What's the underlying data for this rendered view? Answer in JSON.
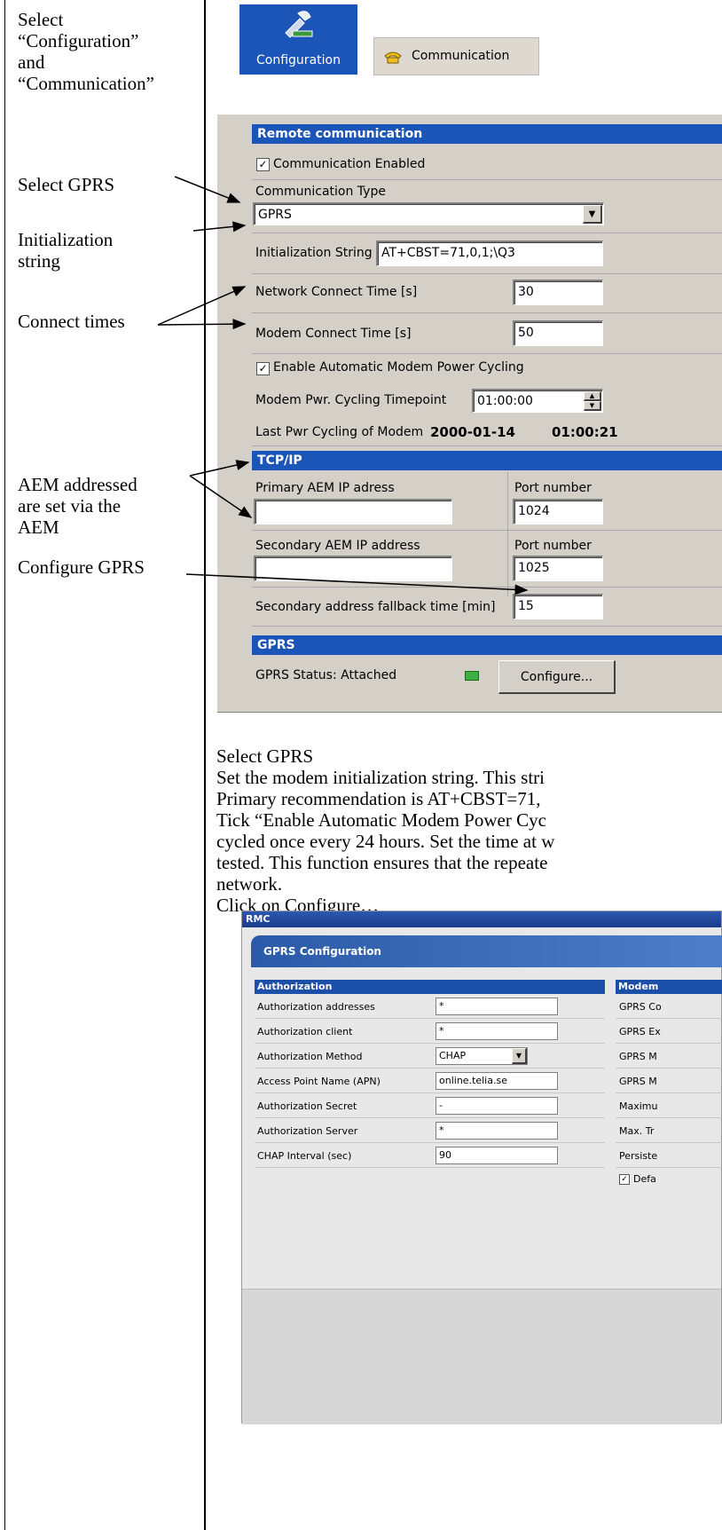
{
  "sidebar": {
    "step1": [
      "Select",
      "“Configuration”",
      "and",
      "“Communication”"
    ],
    "select_gprs": "Select GPRS",
    "init_string": [
      "Initialization",
      "string"
    ],
    "connect_times": "Connect times",
    "aem": [
      "AEM addressed",
      "are set via the",
      "AEM"
    ],
    "configure_gprs": "Configure GPRS"
  },
  "toolbar": {
    "configuration_label": "Configuration",
    "communication_label": "Communication"
  },
  "remote": {
    "header": "Remote communication",
    "comm_enabled_label": "Communication Enabled",
    "comm_enabled_checked": true,
    "comm_type_label": "Communication Type",
    "comm_type_value": "GPRS",
    "init_string_label": "Initialization String",
    "init_string_value": "AT+CBST=71,0,1;\\Q3",
    "network_connect_label": "Network Connect Time [s]",
    "network_connect_value": "30",
    "modem_connect_label": "Modem Connect Time [s]",
    "modem_connect_value": "50",
    "power_cycling_label": "Enable Automatic Modem Power Cycling",
    "power_cycling_checked": true,
    "cycling_timepoint_label": "Modem Pwr. Cycling Timepoint",
    "cycling_timepoint_value": "01:00:00",
    "last_cycling_label": "Last Pwr Cycling of Modem",
    "last_cycling_date": "2000-01-14",
    "last_cycling_time": "01:00:21"
  },
  "tcpip": {
    "header": "TCP/IP",
    "primary_label": "Primary AEM IP adress",
    "primary_value": "",
    "primary_port_label": "Port number",
    "primary_port_value": "1024",
    "secondary_label": "Secondary AEM IP address",
    "secondary_value": "",
    "secondary_port_label": "Port number",
    "secondary_port_value": "1025",
    "fallback_label": "Secondary address fallback time [min]",
    "fallback_value": "15"
  },
  "gprs": {
    "header": "GPRS",
    "status_label": "GPRS Status: Attached",
    "status_color": "#3cb043",
    "configure_button": "Configure..."
  },
  "body_text": [
    "Select GPRS",
    "Set the modem initialization string. This stri",
    "Primary recommendation is AT+CBST=71,",
    "Tick “Enable Automatic Modem Power Cyc",
    "cycled once every 24 hours. Set the time at w",
    "tested. This function ensures that the repeate",
    "network.",
    "Click on Configure…"
  ],
  "rmc": {
    "window_title": "RMC",
    "dialog_title": "GPRS Configuration",
    "auth_header": "Authorization",
    "modem_header": "Modem",
    "auth_rows": [
      {
        "label": "Authorization addresses",
        "value": "*"
      },
      {
        "label": "Authorization client",
        "value": "*"
      },
      {
        "label": "Authorization Method",
        "value": "CHAP"
      },
      {
        "label": "Access Point Name (APN)",
        "value": "online.telia.se"
      },
      {
        "label": "Authorization Secret",
        "value": "-"
      },
      {
        "label": "Authorization Server",
        "value": "*"
      },
      {
        "label": "CHAP Interval (sec)",
        "value": "90"
      }
    ],
    "modem_rows": [
      "GPRS Co",
      "GPRS Ex",
      "GPRS M",
      "GPRS M",
      "Maximu",
      "Max. Tr",
      "Persiste"
    ],
    "default_label": "Defa",
    "default_checked": true
  }
}
